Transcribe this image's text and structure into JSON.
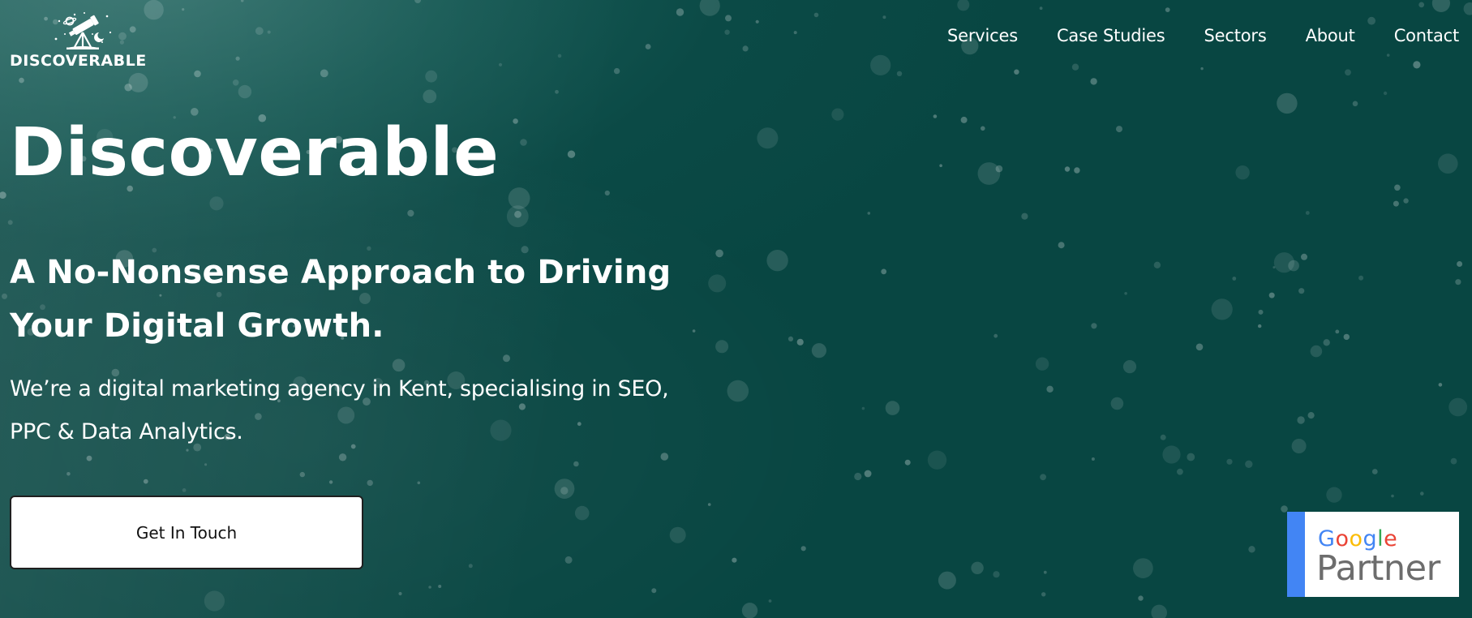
{
  "header": {
    "logo_text": "DISCOVERABLE",
    "logo_icon": "telescope-icon",
    "nav": [
      {
        "label": "Services"
      },
      {
        "label": "Case Studies"
      },
      {
        "label": "Sectors"
      },
      {
        "label": "About"
      },
      {
        "label": "Contact"
      }
    ]
  },
  "hero": {
    "title": "Discoverable",
    "subtitle_line1": "A No-Nonsense Approach to Driving",
    "subtitle_line2": "Your Digital Growth.",
    "description_line1": "We’re a digital marketing agency in Kent, specialising in SEO,",
    "description_line2": "PPC & Data Analytics.",
    "cta_label": "Get In Touch"
  },
  "badge": {
    "google_letters": [
      "G",
      "o",
      "o",
      "g",
      "l",
      "e"
    ],
    "partner_label": "Partner"
  },
  "colors": {
    "background": "#0b4a46",
    "text": "#ffffff",
    "cta_background": "#ffffff",
    "google_blue": "#4285f4",
    "google_red": "#ea4335",
    "google_yellow": "#fbbc05",
    "google_green": "#34a853",
    "partner_gray": "#6d6d6d"
  }
}
